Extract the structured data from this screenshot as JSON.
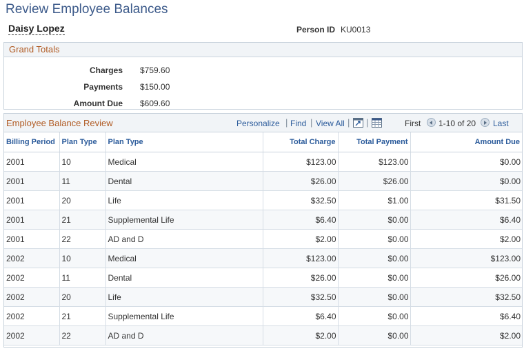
{
  "page": {
    "title": "Review Employee Balances",
    "employee_name": "Daisy Lopez",
    "person_id_label": "Person ID",
    "person_id": "KU0013"
  },
  "grand_totals": {
    "title": "Grand Totals",
    "rows": [
      {
        "label": "Charges",
        "value": "$759.60"
      },
      {
        "label": "Payments",
        "value": "$150.00"
      },
      {
        "label": "Amount Due",
        "value": "$609.60"
      }
    ]
  },
  "grid": {
    "title": "Employee Balance Review",
    "toolbar": {
      "personalize": "Personalize",
      "find": "Find",
      "view_all": "View All",
      "first": "First",
      "range": "1-10 of 20",
      "last": "Last"
    },
    "columns": [
      "Billing Period",
      "Plan Type",
      "Plan Type",
      "Total Charge",
      "Total Payment",
      "Amount Due"
    ],
    "rows": [
      [
        "2001",
        "10",
        "Medical",
        "$123.00",
        "$123.00",
        "$0.00"
      ],
      [
        "2001",
        "11",
        "Dental",
        "$26.00",
        "$26.00",
        "$0.00"
      ],
      [
        "2001",
        "20",
        "Life",
        "$32.50",
        "$1.00",
        "$31.50"
      ],
      [
        "2001",
        "21",
        "Supplemental Life",
        "$6.40",
        "$0.00",
        "$6.40"
      ],
      [
        "2001",
        "22",
        "AD and D",
        "$2.00",
        "$0.00",
        "$2.00"
      ],
      [
        "2002",
        "10",
        "Medical",
        "$123.00",
        "$0.00",
        "$123.00"
      ],
      [
        "2002",
        "11",
        "Dental",
        "$26.00",
        "$0.00",
        "$26.00"
      ],
      [
        "2002",
        "20",
        "Life",
        "$32.50",
        "$0.00",
        "$32.50"
      ],
      [
        "2002",
        "21",
        "Supplemental Life",
        "$6.40",
        "$0.00",
        "$6.40"
      ],
      [
        "2002",
        "22",
        "AD and D",
        "$2.00",
        "$0.00",
        "$2.00"
      ]
    ]
  },
  "colors": {
    "title_blue": "#3c5a8a",
    "link_blue": "#2b5b9b",
    "section_orange": "#b05a22",
    "header_bg": "#f1f4f7",
    "border": "#c9d3dd"
  },
  "icons": {
    "zoom": "zoom-grid-icon",
    "download": "download-spreadsheet-icon",
    "prev": "previous-arrow-icon",
    "next": "next-arrow-icon"
  }
}
